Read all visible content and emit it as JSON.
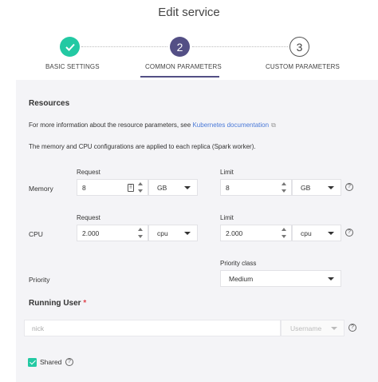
{
  "title": "Edit service",
  "steps": [
    {
      "number": "1",
      "label": "BASIC SETTINGS",
      "status": "completed"
    },
    {
      "number": "2",
      "label": "COMMON PARAMETERS",
      "status": "active"
    },
    {
      "number": "3",
      "label": "CUSTOM PARAMETERS",
      "status": "pending"
    }
  ],
  "resources": {
    "heading": "Resources",
    "info_prefix": "For more information about the resource parameters, see",
    "info_link": "Kubernetes documentation",
    "info_replica": "The memory and CPU configurations are applied to each replica (Spark worker).",
    "request_label": "Request",
    "limit_label": "Limit",
    "memory": {
      "label": "Memory",
      "request_value": "8",
      "request_unit": "GB",
      "limit_value": "8",
      "limit_unit": "GB"
    },
    "cpu": {
      "label": "CPU",
      "request_value": "2.000",
      "request_unit": "cpu",
      "limit_value": "2.000",
      "limit_unit": "cpu"
    },
    "priority": {
      "label": "Priority",
      "class_label": "Priority class",
      "value": "Medium"
    }
  },
  "running_user": {
    "heading": "Running User",
    "required_mark": "*",
    "value": "nick",
    "type_placeholder": "Username",
    "shared_label": "Shared",
    "shared_checked": true
  },
  "colors": {
    "completed": "#23c9a3",
    "active": "#534f85",
    "link": "#4a79d8",
    "required": "#e0434d",
    "panel_bg": "#f4f4f7"
  },
  "icons": {
    "completed_step": "check-icon",
    "help": "question-circle-icon",
    "external": "external-link-icon",
    "dropdown": "chevron-down-icon",
    "spinner": "stepper-arrows-icon",
    "keyboard": "keyboard-icon"
  }
}
